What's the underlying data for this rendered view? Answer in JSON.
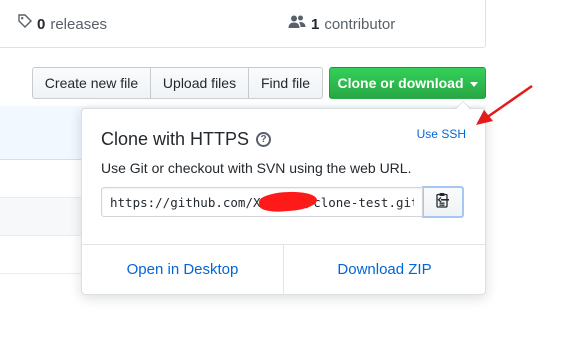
{
  "summary": {
    "releases_count": "0",
    "releases_label": "releases",
    "contributors_count": "1",
    "contributors_label": "contributor"
  },
  "toolbar": {
    "create_new_file": "Create new file",
    "upload_files": "Upload files",
    "find_file": "Find file",
    "clone_or_download": "Clone or download"
  },
  "clone_panel": {
    "title": "Clone with HTTPS",
    "use_ssh": "Use SSH",
    "description": "Use Git or checkout with SVN using the web URL.",
    "url": "https://github.com/XXXXXXX/clone-test.git",
    "open_in_desktop": "Open in Desktop",
    "download_zip": "Download ZIP"
  },
  "icons": {
    "tag": "tag-icon",
    "people": "people-icon",
    "help": "question-icon",
    "clipboard": "clipboard-icon",
    "caret": "caret-down-icon"
  },
  "colors": {
    "primary_green": "#28a745",
    "link_blue": "#0366d6",
    "annotation_red": "#e31b1b"
  }
}
